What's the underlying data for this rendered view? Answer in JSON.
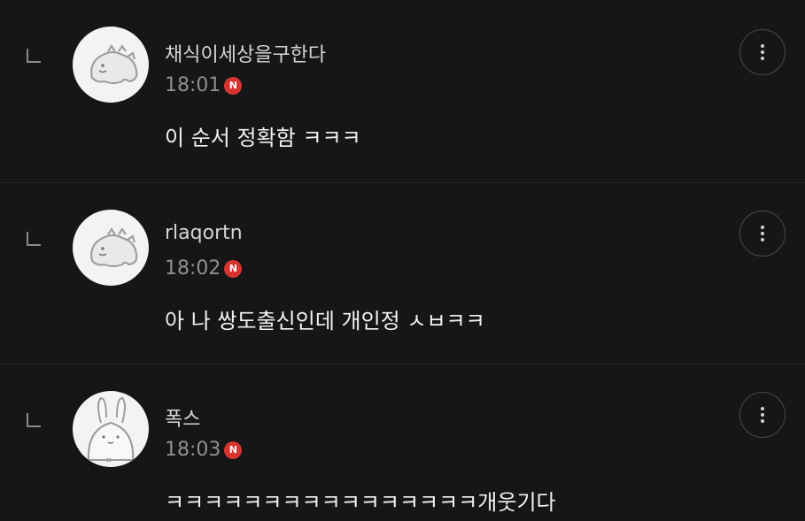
{
  "comments": [
    {
      "username": "채식이세상을구한다",
      "time": "18:01",
      "badge": "N",
      "text": "이 순서 정확함 ㅋㅋㅋ",
      "avatar_icon": "dinosaur-avatar-icon"
    },
    {
      "username": "rlaqortn",
      "time": "18:02",
      "badge": "N",
      "text": "아 나 쌍도출신인데 개인정 ㅅㅂㅋㅋ",
      "avatar_icon": "dinosaur-avatar-icon"
    },
    {
      "username": "폭스",
      "time": "18:03",
      "badge": "N",
      "text": "ㅋㅋㅋㅋㅋㅋㅋㅋㅋㅋㅋㅋㅋㅋㅋㅋ개웃기다",
      "avatar_icon": "rabbit-avatar-icon"
    }
  ],
  "colors": {
    "background": "#161616",
    "badge": "#d8342f",
    "time": "#8f8f8f",
    "divider": "#242424"
  }
}
